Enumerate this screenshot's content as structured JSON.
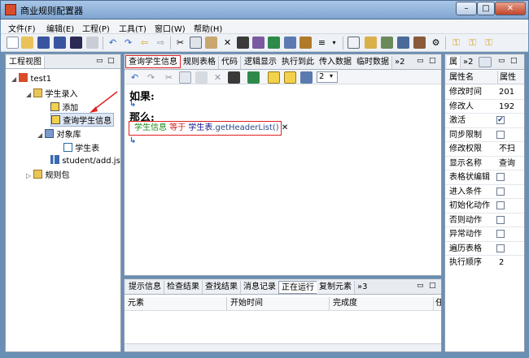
{
  "window": {
    "title": "商业规则配置器",
    "controls": {
      "minimize": "–",
      "maximize": "□",
      "close": "✕"
    }
  },
  "menu": [
    "文件(F)",
    "编辑(E)",
    "工程(P)",
    "工具(T)",
    "窗口(W)",
    "帮助(H)"
  ],
  "left_panel": {
    "title": "工程视图",
    "tree": [
      {
        "label": "test1",
        "level": 0,
        "expander": "◢",
        "icon": "project-icon"
      },
      {
        "label": "学生录入",
        "level": 1,
        "expander": "◢",
        "icon": "folder-icon"
      },
      {
        "label": "添加",
        "level": 2,
        "expander": "",
        "icon": "rule-icon"
      },
      {
        "label": "查询学生信息",
        "level": 2,
        "expander": "",
        "icon": "rule-icon"
      },
      {
        "label": "对象库",
        "level": 2,
        "expander": "◢",
        "icon": "object-library-icon"
      },
      {
        "label": "学生表",
        "level": 3,
        "expander": "",
        "icon": "table-icon"
      },
      {
        "label": "student/add.js",
        "level": 2,
        "expander": "",
        "icon": "chart-file-icon"
      },
      {
        "label": "规则包",
        "level": 1,
        "expander": "▷",
        "icon": "folder-icon"
      }
    ]
  },
  "editor": {
    "tabs": [
      "查询学生信息",
      "规则表格",
      "代码",
      "逻辑显示",
      "执行到此",
      "传入数据",
      "临时数据",
      "»2"
    ],
    "zoom_value": "2",
    "if_label": "如果:",
    "then_label": "那么:",
    "action": {
      "target": "学生信息",
      "operator": "等于",
      "value": "学生表",
      "method": ".getHeaderList()",
      "remove": "✕"
    }
  },
  "bottom_panel": {
    "tabs": [
      "提示信息",
      "检查结果",
      "查找结果",
      "消息记录",
      "正在运行",
      "复制元素",
      "»3"
    ],
    "columns": [
      "元素",
      "开始时间",
      "完成度",
      "任"
    ]
  },
  "right_panel": {
    "tabs": [
      "属",
      "»2"
    ],
    "header": [
      "属性名",
      "属性"
    ],
    "rows": [
      {
        "name": "修改时间",
        "value": "201",
        "checkbox": false
      },
      {
        "name": "修改人",
        "value": "192",
        "checkbox": false
      },
      {
        "name": "激活",
        "value": "",
        "checkbox": true,
        "checked": true
      },
      {
        "name": "同步限制",
        "value": "",
        "checkbox": true,
        "checked": false
      },
      {
        "name": "修改权限",
        "value": "不扫",
        "checkbox": false
      },
      {
        "name": "显示名称",
        "value": "查询",
        "checkbox": false
      },
      {
        "name": "表格状编辑",
        "value": "",
        "checkbox": true,
        "checked": false
      },
      {
        "name": "进入条件",
        "value": "",
        "checkbox": true,
        "checked": false
      },
      {
        "name": "初始化动作",
        "value": "",
        "checkbox": true,
        "checked": false
      },
      {
        "name": "否则动作",
        "value": "",
        "checkbox": true,
        "checked": false
      },
      {
        "name": "异常动作",
        "value": "",
        "checkbox": true,
        "checked": false
      },
      {
        "name": "遍历表格",
        "value": "",
        "checkbox": true,
        "checked": false
      },
      {
        "name": "执行顺序",
        "value": "2",
        "checkbox": false
      }
    ]
  },
  "colors": {
    "highlight": "#e02020",
    "keyword_green": "#1c8a1c",
    "operator_red": "#d02020",
    "accent_blue": "#2864c8"
  }
}
